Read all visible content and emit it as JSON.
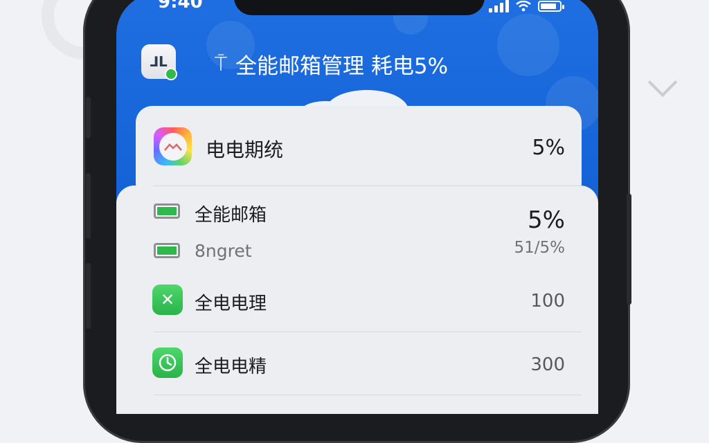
{
  "status_bar": {
    "time": "9:40"
  },
  "header": {
    "title": "全能邮箱管理 耗电5%"
  },
  "summary_card": {
    "label": "电电期统",
    "value": "5%"
  },
  "list": [
    {
      "label": "全能邮箱",
      "value": "5%",
      "icon": "battery-icon"
    },
    {
      "label": "8ngret",
      "value": "51/5%",
      "icon": "battery-icon"
    },
    {
      "label": "全电电理",
      "value": "100",
      "icon": "app-x-icon"
    },
    {
      "label": "全电电精",
      "value": "300",
      "icon": "clock-icon"
    }
  ],
  "colors": {
    "screen_bg": "#1565d8",
    "card_bg": "#eceef2",
    "accent_green": "#2fb84b"
  }
}
